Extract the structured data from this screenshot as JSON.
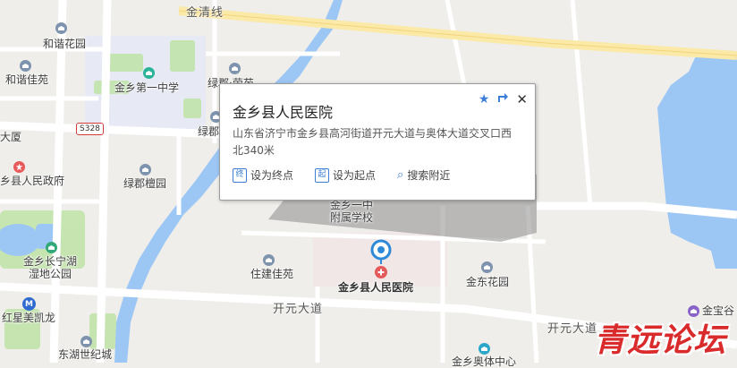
{
  "roads": {
    "jinqing": "金清线",
    "kaiyuan": "开元大道",
    "kaiyuan_right": "开元大道",
    "s328": "S328"
  },
  "places": {
    "hexie_garden": "和谐花园",
    "hexie_jiayuan": "和谐佳苑",
    "jx_no1_middle": "金乡第一中学",
    "lvjun_rongyuan": "绿郡·荣苑",
    "lvjun": "绿郡",
    "dasha": "大厦",
    "gov": "乡县人民政府",
    "lvjun_tanyuan": "绿郡檀园",
    "jx_changning_1": "金乡长宁湖",
    "jx_changning_2": "湿地公园",
    "hongxing": "红星美凯龙",
    "zhujian": "住建佳苑",
    "donghu": "东湖世纪城",
    "jx_affil_1": "金乡一中",
    "jx_affil_2": "附属学校",
    "hospital": "金乡县人民医院",
    "jindong": "金东花园",
    "jinbao": "金宝谷",
    "bottom_mid": "金乡奥体中心"
  },
  "popup": {
    "title": "金乡县人民医院",
    "address": "山东省济宁市金乡县高河街道开元大道与奥体大道交叉口西北340米",
    "actions": {
      "end": "设为终点",
      "start": "设为起点",
      "nearby": "搜索附近"
    },
    "icons": [
      "star-icon",
      "share-icon",
      "close-icon"
    ]
  },
  "watermark": "青远论坛",
  "colors": {
    "water": "#9cc6f4",
    "green": "#bfe3a6",
    "road": "#ffffff",
    "highway": "#fbe9a8",
    "marker": "#2e89d9",
    "watermark": "#d92b2b"
  }
}
